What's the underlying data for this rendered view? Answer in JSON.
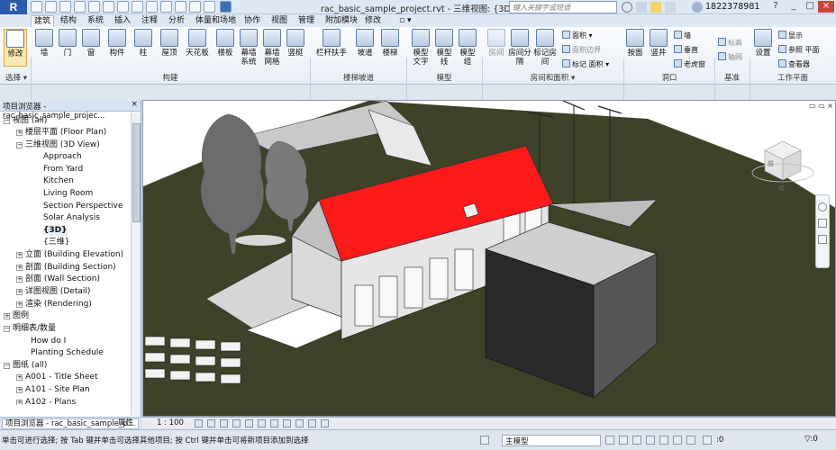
{
  "titlebar": {
    "app_logo": "R",
    "doc_title": "rac_basic_sample_project.rvt - 三维视图: {3D}",
    "search_placeholder": "键入关键字或短语",
    "user_name": "1822378981",
    "help_label": "?"
  },
  "ribbon_tabs": [
    "建筑",
    "结构",
    "系统",
    "插入",
    "注释",
    "分析",
    "体量和场地",
    "协作",
    "视图",
    "管理",
    "附加模块",
    "修改"
  ],
  "ribbon_tab_active": "建筑",
  "ribbon": {
    "modify": "修改",
    "select_label": "选择 ▾",
    "build_buttons": [
      "墙",
      "门",
      "窗",
      "构件",
      "柱",
      "屋顶",
      "天花板",
      "楼板",
      "幕墙系统",
      "幕墙网格",
      "竖梃"
    ],
    "circulation_buttons": [
      "栏杆扶手",
      "坡道",
      "楼梯"
    ],
    "model_buttons": [
      "模型文字",
      "模型线",
      "模型组"
    ],
    "room_buttons": [
      "房间",
      "房间分隔",
      "标记房间"
    ],
    "room_small": [
      "面积 ▾",
      "面积边界",
      "标记 面积 ▾",
      "面积 ▾"
    ],
    "opening_buttons": [
      "按面",
      "竖井"
    ],
    "opening_small": [
      "墙",
      "垂直",
      "老虎窗"
    ],
    "datum_small": [
      "标高",
      "轴网"
    ],
    "workplane_buttons": [
      "设置"
    ],
    "workplane_small": [
      "显示",
      "参照 平面",
      "查看器"
    ],
    "panels": [
      "选择 ▾",
      "构建",
      "楼梯坡道",
      "模型",
      "房间和面积 ▾",
      "洞口",
      "基准",
      "工作平面"
    ]
  },
  "browser": {
    "title": "项目浏览器 - rac_basic_sample_projec...",
    "close": "×",
    "items": [
      {
        "label": "视图 (all)",
        "tog": "−"
      },
      {
        "label": "楼层平面 (Floor Plan)",
        "tog": "+"
      },
      {
        "label": "三维视图 (3D View)",
        "tog": "−"
      },
      {
        "label": "Approach",
        "tog": ""
      },
      {
        "label": "From Yard",
        "tog": ""
      },
      {
        "label": "Kitchen",
        "tog": ""
      },
      {
        "label": "Living Room",
        "tog": ""
      },
      {
        "label": "Section Perspective",
        "tog": ""
      },
      {
        "label": "Solar Analysis",
        "tog": ""
      },
      {
        "label": "{3D}",
        "tog": ""
      },
      {
        "label": "{三维}",
        "tog": ""
      },
      {
        "label": "立面 (Building Elevation)",
        "tog": "+"
      },
      {
        "label": "剖面 (Building Section)",
        "tog": "+"
      },
      {
        "label": "剖面 (Wall Section)",
        "tog": "+"
      },
      {
        "label": "详图视图 (Detail)",
        "tog": "+"
      },
      {
        "label": "渲染 (Rendering)",
        "tog": "+"
      },
      {
        "label": "图例",
        "tog": "+"
      },
      {
        "label": "明细表/数量",
        "tog": "−"
      },
      {
        "label": "How do I",
        "tog": ""
      },
      {
        "label": "Planting Schedule",
        "tog": ""
      },
      {
        "label": "图纸 (all)",
        "tog": "−"
      },
      {
        "label": "A001 - Title Sheet",
        "tog": "+"
      },
      {
        "label": "A101 - Site Plan",
        "tog": "+"
      },
      {
        "label": "A102 - Plans",
        "tog": "+"
      }
    ],
    "tabs": [
      "项目浏览器 - rac_basic_sample_p...",
      "属性"
    ]
  },
  "viewcube": {
    "front": "前",
    "bottom": "南"
  },
  "view_controls": {
    "scale": "1 : 100"
  },
  "status": {
    "text": "单击可进行选择; 按 Tab 键并单击可选择其他项目; 按 Ctrl 键并单击可将新项目添加到选择",
    "model": "主模型",
    "count": ":0",
    "filter": "▽:0"
  },
  "colors": {
    "roof": "#ff1a1a",
    "ground": "#3d4228",
    "accent": "#2a5ca8"
  }
}
